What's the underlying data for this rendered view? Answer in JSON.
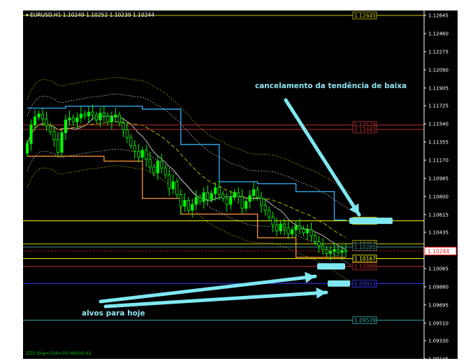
{
  "header": {
    "symbol_line": "EURUSD,H1  1.10249 1.10252 1.10239 1.10244"
  },
  "footer": {
    "indicator_text": "ZZ3 (Sig=334=55) AV(05-02"
  },
  "annotations": {
    "cancel": "cancelamento da tendência de baixa",
    "targets": "alvos para hoje"
  },
  "colors": {
    "background": "#000000",
    "candle_up": "#00ff00",
    "candle_down": "#000000",
    "candle_border": "#00ff00",
    "annotation": "#8fe3f2",
    "highlight": "#7fe8f2",
    "axis_text": "#ffffff"
  },
  "chart_data": {
    "type": "candlestick",
    "symbol": "EURUSD",
    "timeframe": "H1",
    "ohlc_last": {
      "open": 1.10249,
      "high": 1.10252,
      "low": 1.10239,
      "close": 1.10244
    },
    "ylim": [
      1.09145,
      1.12695
    ],
    "y_ticks": [
      1.12645,
      1.1246,
      1.12275,
      1.1209,
      1.11905,
      1.11725,
      1.1154,
      1.11355,
      1.1117,
      1.10985,
      1.108,
      1.10615,
      1.10435,
      1.1025,
      1.10065,
      1.0988,
      1.09695,
      1.0951,
      1.0933,
      1.09145
    ],
    "y_tick_labels": [
      "1.12645",
      "1.12460",
      "1.12275",
      "1.12090",
      "1.11905",
      "1.11725",
      "1.11540",
      "1.11355",
      "1.11170",
      "1.10985",
      "1.10800",
      "1.10615",
      "1.10435",
      "1.10250",
      "1.10065",
      "1.09880",
      "1.09695",
      "1.09510",
      "1.09330",
      "1.09145"
    ],
    "horizontal_levels": [
      {
        "value": 1.12645,
        "label": "1.12645",
        "color": "#c8c800"
      },
      {
        "value": 1.11528,
        "label": "1.11528",
        "color": "#c03030"
      },
      {
        "value": 1.11483,
        "label": "1.11483",
        "color": "#c03030"
      },
      {
        "value": 1.10552,
        "label": "1.10552",
        "color": "#ffff00"
      },
      {
        "value": 1.10317,
        "label": "1.10317",
        "color": "#c8c800"
      },
      {
        "value": 1.10285,
        "label": "1.10285",
        "color": "#4a8a8a"
      },
      {
        "value": 1.10167,
        "label": "1.10167",
        "color": "#ffff00"
      },
      {
        "value": 1.10088,
        "label": "1.10088",
        "color": "#c03030"
      },
      {
        "value": 1.09913,
        "label": "1.09913",
        "color": "#3a3aff"
      },
      {
        "value": 1.09539,
        "label": "1.09539",
        "color": "#39b0b0"
      }
    ],
    "current_price": {
      "value": 1.10244,
      "label": "1.10244",
      "color": "#ff2020"
    },
    "close_series": [
      1.1134,
      1.1153,
      1.1161,
      1.1164,
      1.1159,
      1.1152,
      1.1146,
      1.1138,
      1.1125,
      1.1145,
      1.1158,
      1.116,
      1.1156,
      1.116,
      1.1164,
      1.1162,
      1.1166,
      1.1163,
      1.1158,
      1.1165,
      1.1162,
      1.1156,
      1.1161,
      1.1163,
      1.1155,
      1.1148,
      1.114,
      1.1132,
      1.1126,
      1.112,
      1.1127,
      1.1118,
      1.111,
      1.1104,
      1.1116,
      1.1109,
      1.1102,
      1.1088,
      1.1095,
      1.1082,
      1.107,
      1.1076,
      1.1066,
      1.1072,
      1.1079,
      1.1075,
      1.1084,
      1.1077,
      1.1083,
      1.1089,
      1.1082,
      1.1078,
      1.1072,
      1.1079,
      1.1084,
      1.108,
      1.1068,
      1.1075,
      1.1081,
      1.1087,
      1.1079,
      1.1071,
      1.1066,
      1.1059,
      1.1051,
      1.1045,
      1.1052,
      1.1048,
      1.1042,
      1.1046,
      1.105,
      1.1047,
      1.1043,
      1.1046,
      1.104,
      1.1034,
      1.103,
      1.1026,
      1.1022,
      1.1024,
      1.1026,
      1.1023,
      1.1025,
      1.1024
    ]
  }
}
